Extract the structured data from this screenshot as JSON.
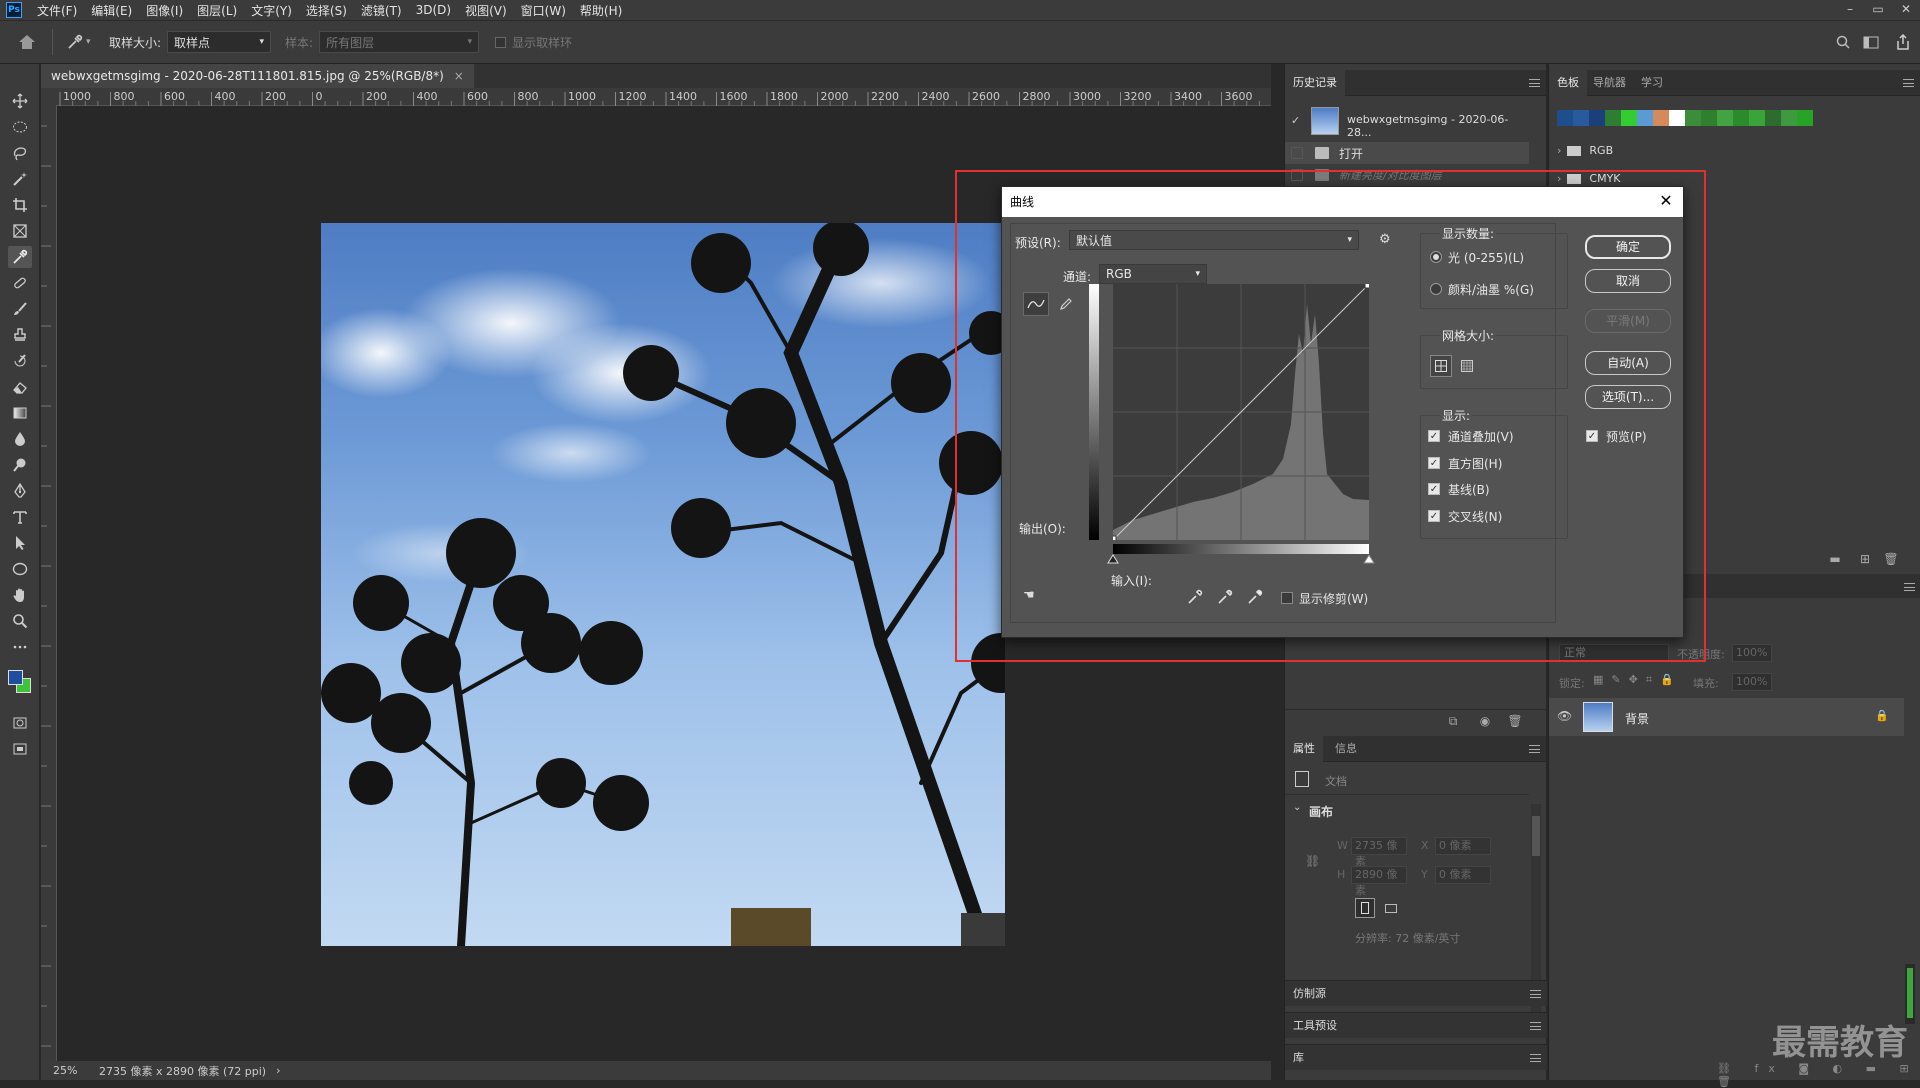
{
  "app": {
    "logo": "Ps"
  },
  "menu": [
    "文件(F)",
    "编辑(E)",
    "图像(I)",
    "图层(L)",
    "文字(Y)",
    "选择(S)",
    "滤镜(T)",
    "3D(D)",
    "视图(V)",
    "窗口(W)",
    "帮助(H)"
  ],
  "window_controls": [
    "–",
    "▭",
    "✕"
  ],
  "options_bar": {
    "sample_size_label": "取样大小:",
    "sample_size_value": "取样点",
    "sample_label": "样本:",
    "sample_value": "所有图层",
    "show_ring_label": "显示取样环"
  },
  "document": {
    "tab_title": "webwxgetmsgimg - 2020-06-28T111801.815.jpg @ 25%(RGB/8*)",
    "tab_close": "×",
    "ruler_labels": [
      "1000",
      "800",
      "600",
      "400",
      "200",
      "0",
      "200",
      "400",
      "600",
      "800",
      "1000",
      "1200",
      "1400",
      "1600",
      "1800",
      "2000",
      "2200",
      "2400",
      "2600",
      "2800",
      "3000",
      "3200",
      "3400",
      "3600"
    ]
  },
  "status": {
    "zoom": "25%",
    "info": "2735 像素 x 2890 像素 (72 ppi)",
    "arrow": "›"
  },
  "history_panel": {
    "tab": "历史记录",
    "snapshot_name": "webwxgetmsgimg - 2020-06-28...",
    "steps": [
      "打开",
      "新建亮度/对比度图层"
    ]
  },
  "swatches_panel": {
    "tabs": [
      "色板",
      "导航器",
      "学习"
    ],
    "colors": [
      "#1f4e8c",
      "#2a5a9e",
      "#1b3f7a",
      "#2e7d32",
      "#33cc33",
      "#5b9bd5",
      "#d48a5a",
      "#ffffff",
      "#3c8c3c",
      "#2f7f2f",
      "#43a343",
      "#2b8a2b",
      "#3aa33a",
      "#2e6b2e",
      "#3f9a3f",
      "#27a327"
    ],
    "groups": [
      "RGB",
      "CMYK"
    ]
  },
  "layers_panel": {
    "blend_mode": "正常",
    "opacity_label": "不透明度:",
    "opacity_value": "100%",
    "lock_label": "锁定:",
    "fill_label": "填充:",
    "fill_value": "100%",
    "layer_name": "背景"
  },
  "properties_panel": {
    "tabs": [
      "属性",
      "信息"
    ],
    "doc_label": "文档",
    "section": "画布",
    "w_label": "W",
    "w_value": "2735 像素",
    "h_label": "H",
    "h_value": "2890 像素",
    "x_label": "X",
    "x_value": "0 像素",
    "y_label": "Y",
    "y_value": "0 像素",
    "resolution": "分辨率: 72 像素/英寸"
  },
  "collapsed_panels": [
    "仿制源",
    "工具预设",
    "库"
  ],
  "curves_dialog": {
    "title": "曲线",
    "close": "✕",
    "preset_label": "预设(R):",
    "preset_value": "默认值",
    "channel_label": "通道:",
    "channel_value": "RGB",
    "output_label": "输出(O):",
    "input_label": "输入(I):",
    "show_clipping": "显示修剪(W)",
    "show_amount_title": "显示数量:",
    "light_option": "光 (0-255)(L)",
    "pigment_option": "颜料/油墨 %(G)",
    "grid_size_title": "网格大小:",
    "display_title": "显示:",
    "display_options": [
      "通道叠加(V)",
      "直方图(H)",
      "基线(B)",
      "交叉线(N)"
    ],
    "buttons": {
      "ok": "确定",
      "cancel": "取消",
      "smooth": "平滑(M)",
      "auto": "自动(A)",
      "options": "选项(T)...",
      "preview": "预览(P)"
    }
  },
  "watermark": "最需教育"
}
